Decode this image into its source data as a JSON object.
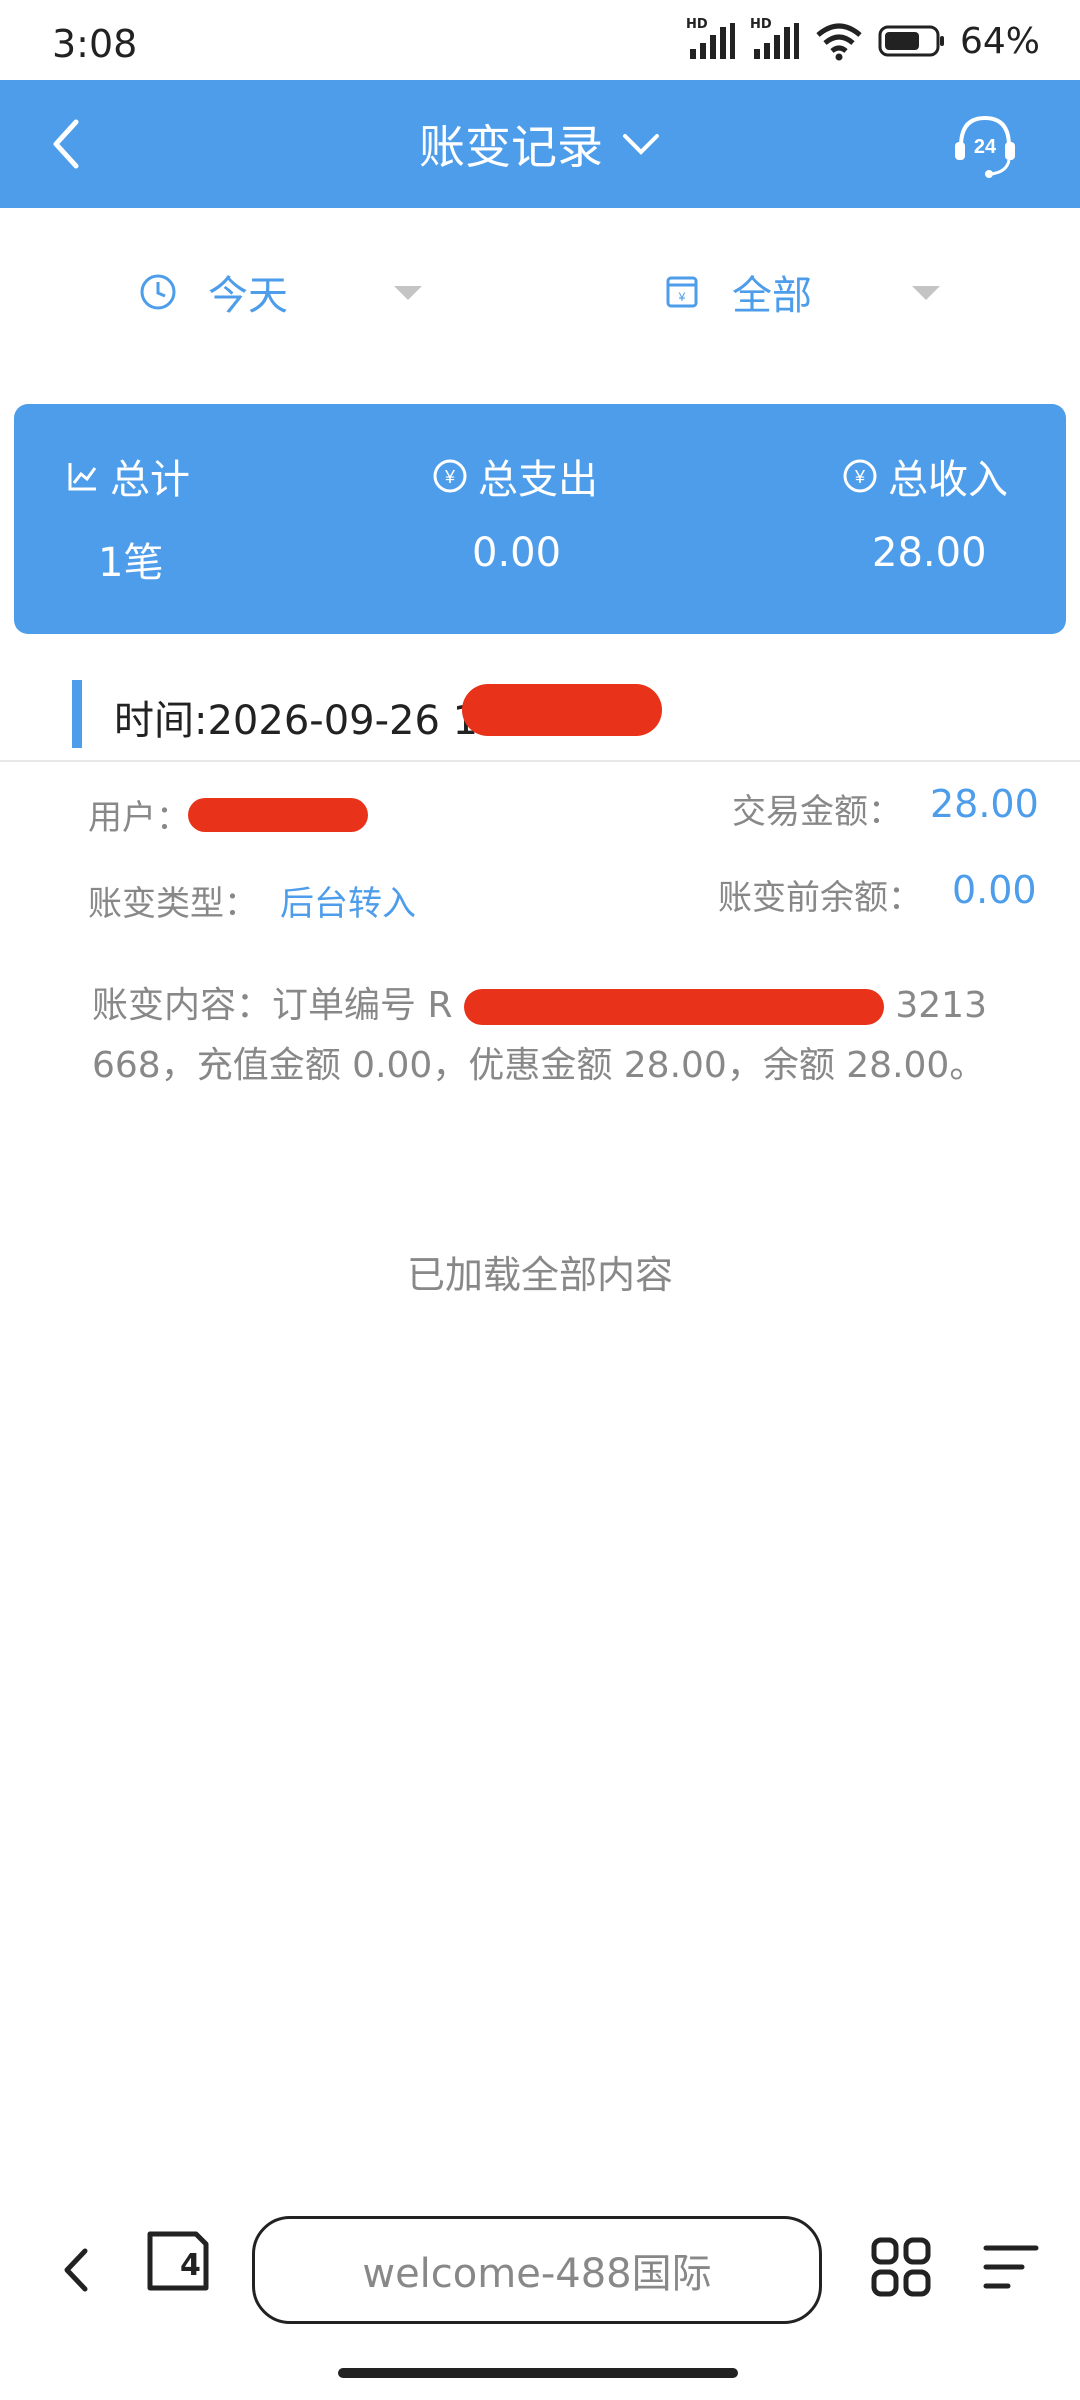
{
  "status_bar": {
    "time": "3:08",
    "battery": "64%",
    "signal1": "HD",
    "signal2": "HD"
  },
  "header": {
    "title": "账变记录",
    "back_icon": "chevron-left-icon",
    "support_icon": "headset-24-icon",
    "support_badge": "24"
  },
  "filters": [
    {
      "label": "今天",
      "icon": "clock-icon"
    },
    {
      "label": "全部",
      "icon": "calendar-icon"
    }
  ],
  "summary": {
    "total_label": "总计",
    "total_value": "1笔",
    "expense_label": "总支出",
    "expense_value": "0.00",
    "income_label": "总收入",
    "income_value": "28.00"
  },
  "record": {
    "time_label": "时间:2026-09-26 1",
    "user_label": "用户：",
    "amount_label": "交易金额：",
    "amount_value": "28.00",
    "type_label": "账变类型：",
    "type_value": "后台转入",
    "balance_before_label": "账变前余额：",
    "balance_before_value": "0.00",
    "content_start": "账变内容：订单编号 R",
    "content_tail": "32136",
    "content_rest": "68，充值金额 0.00，优惠金额 28.00，余额 28.00。"
  },
  "list_footer": "已加载全部内容",
  "browser": {
    "url_text": "welcome-488国际",
    "tabs_count": "4"
  },
  "colors": {
    "accent": "#4d9deb",
    "redaction": "#e8321a"
  }
}
